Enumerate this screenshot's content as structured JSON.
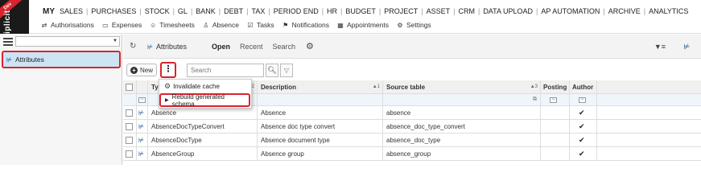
{
  "app": {
    "logo_text": "iplicit",
    "env_badge": "Dev"
  },
  "main_nav": [
    "MY",
    "SALES",
    "PURCHASES",
    "STOCK",
    "GL",
    "BANK",
    "DEBT",
    "TAX",
    "PERIOD END",
    "HR",
    "BUDGET",
    "PROJECT",
    "ASSET",
    "CRM",
    "DATA UPLOAD",
    "AP AUTOMATION",
    "ARCHIVE",
    "ANALYTICS"
  ],
  "sub_nav": [
    {
      "label": "Authorisations",
      "icon": "flow-icon"
    },
    {
      "label": "Expenses",
      "icon": "card-icon"
    },
    {
      "label": "Timesheets",
      "icon": "user-clock-icon"
    },
    {
      "label": "Absence",
      "icon": "person-icon"
    },
    {
      "label": "Tasks",
      "icon": "check-icon"
    },
    {
      "label": "Notifications",
      "icon": "flag-icon"
    },
    {
      "label": "Appointments",
      "icon": "calendar-icon"
    },
    {
      "label": "Settings",
      "icon": "gear-icon"
    }
  ],
  "sidebar": {
    "select_value": "",
    "item_label": "Attributes"
  },
  "page": {
    "title": "Attributes",
    "tabs": [
      "Open",
      "Recent",
      "Search"
    ]
  },
  "toolbar": {
    "new_label": "New",
    "more_label": "⋮",
    "search_placeholder": "Search"
  },
  "menu": {
    "items": [
      "Invalidate cache",
      "Rebuild generated schema"
    ]
  },
  "grid": {
    "columns": [
      {
        "label": "Typ",
        "sort": "2"
      },
      {
        "label": "Description",
        "sort": "1"
      },
      {
        "label": "Source table",
        "sort": "3"
      },
      {
        "label": "Posting",
        "sort": ""
      },
      {
        "label": "Author",
        "sort": ""
      }
    ],
    "rows": [
      {
        "type": "Absence",
        "description": "Absence",
        "source_table": "absence",
        "author_check": "✔"
      },
      {
        "type": "AbsenceDocTypeConvert",
        "description": "Absence doc type convert",
        "source_table": "absence_doc_type_convert",
        "author_check": "✔"
      },
      {
        "type": "AbsenceDocType",
        "description": "Absence document type",
        "source_table": "absence_doc_type",
        "author_check": "✔"
      },
      {
        "type": "AbsenceGroup",
        "description": "Absence group",
        "source_table": "absence_group",
        "author_check": "✔"
      }
    ]
  }
}
